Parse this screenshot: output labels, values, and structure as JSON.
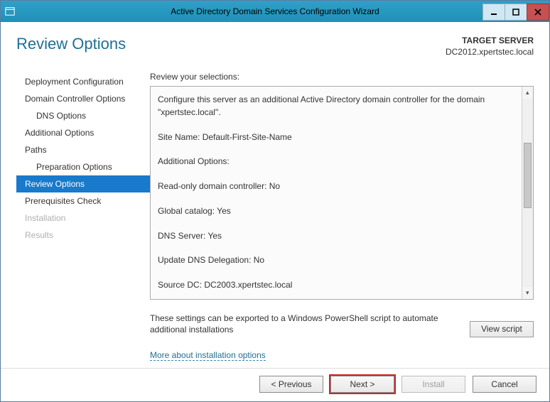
{
  "window": {
    "title": "Active Directory Domain Services Configuration Wizard"
  },
  "header": {
    "page_title": "Review Options",
    "target_label": "TARGET SERVER",
    "target_value": "DC2012.xpertstec.local"
  },
  "sidebar": {
    "items": [
      {
        "label": "Deployment Configuration",
        "indent": false,
        "selected": false,
        "disabled": false
      },
      {
        "label": "Domain Controller Options",
        "indent": false,
        "selected": false,
        "disabled": false
      },
      {
        "label": "DNS Options",
        "indent": true,
        "selected": false,
        "disabled": false
      },
      {
        "label": "Additional Options",
        "indent": false,
        "selected": false,
        "disabled": false
      },
      {
        "label": "Paths",
        "indent": false,
        "selected": false,
        "disabled": false
      },
      {
        "label": "Preparation Options",
        "indent": true,
        "selected": false,
        "disabled": false
      },
      {
        "label": "Review Options",
        "indent": false,
        "selected": true,
        "disabled": false
      },
      {
        "label": "Prerequisites Check",
        "indent": false,
        "selected": false,
        "disabled": false
      },
      {
        "label": "Installation",
        "indent": false,
        "selected": false,
        "disabled": true
      },
      {
        "label": "Results",
        "indent": false,
        "selected": false,
        "disabled": true
      }
    ]
  },
  "main": {
    "review_label": "Review your selections:",
    "review_text": "Configure this server as an additional Active Directory domain controller for the domain \"xpertstec.local\".\n\nSite Name: Default-First-Site-Name\n\nAdditional Options:\n\n  Read-only domain controller: No\n\n  Global catalog: Yes\n\n  DNS Server: Yes\n\n  Update DNS Delegation: No\n\nSource DC: DC2003.xpertstec.local",
    "export_text": "These settings can be exported to a Windows PowerShell script to automate additional installations",
    "view_script_label": "View script",
    "more_link": "More about installation options"
  },
  "footer": {
    "previous": "< Previous",
    "next": "Next >",
    "install": "Install",
    "cancel": "Cancel"
  }
}
